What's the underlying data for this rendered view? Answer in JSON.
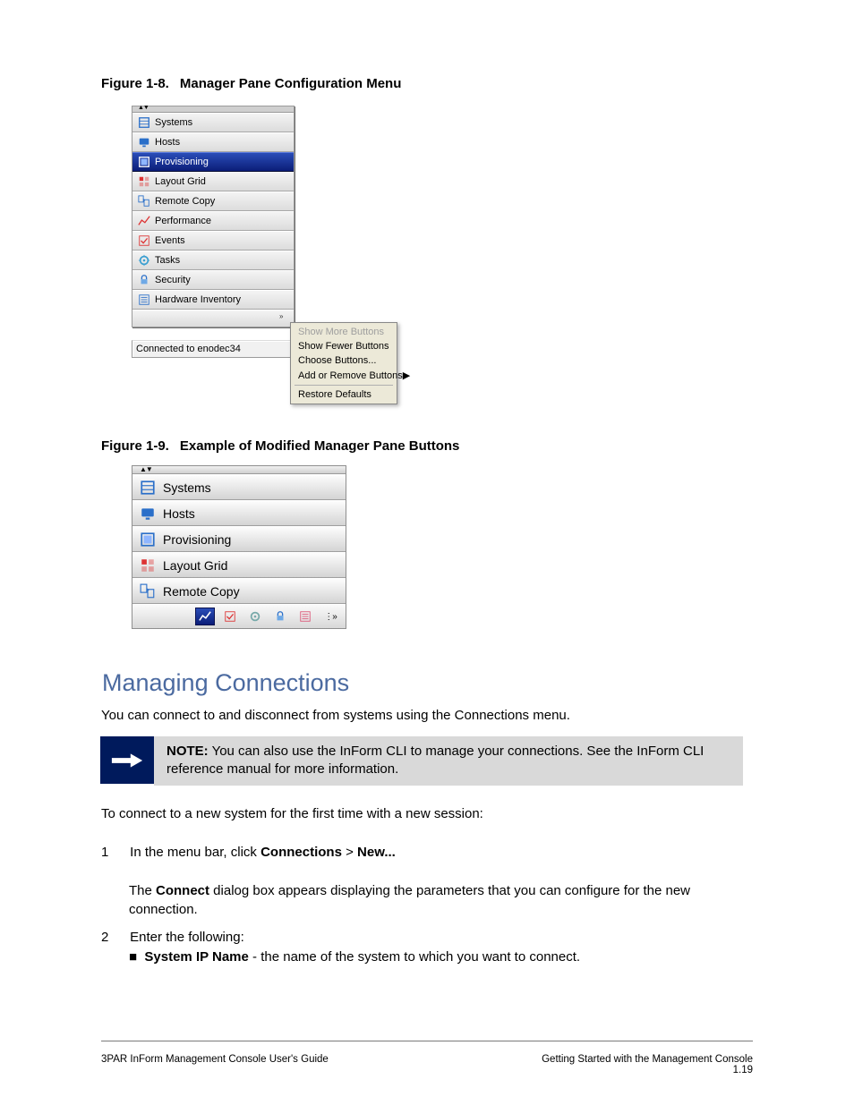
{
  "figure1": {
    "caption_label": "Figure 1-8.",
    "caption_text": "Manager Pane Configuration Menu",
    "nav_items": [
      {
        "label": "Systems",
        "selected": false,
        "icon": "systems-icon"
      },
      {
        "label": "Hosts",
        "selected": false,
        "icon": "hosts-icon"
      },
      {
        "label": "Provisioning",
        "selected": true,
        "icon": "provisioning-icon"
      },
      {
        "label": "Layout Grid",
        "selected": false,
        "icon": "layout-grid-icon"
      },
      {
        "label": "Remote Copy",
        "selected": false,
        "icon": "remote-copy-icon"
      },
      {
        "label": "Performance",
        "selected": false,
        "icon": "performance-icon"
      },
      {
        "label": "Events",
        "selected": false,
        "icon": "events-icon"
      },
      {
        "label": "Tasks",
        "selected": false,
        "icon": "tasks-icon"
      },
      {
        "label": "Security",
        "selected": false,
        "icon": "security-icon"
      },
      {
        "label": "Hardware Inventory",
        "selected": false,
        "icon": "hardware-inventory-icon"
      }
    ],
    "status_text": "Connected to enodec34",
    "context_menu": [
      {
        "label": "Show More Buttons",
        "disabled": true,
        "submenu": false
      },
      {
        "label": "Show Fewer Buttons",
        "disabled": false,
        "submenu": false
      },
      {
        "label": "Choose Buttons...",
        "disabled": false,
        "submenu": false
      },
      {
        "label": "Add or Remove Buttons",
        "disabled": false,
        "submenu": true
      },
      {
        "label": "Restore Defaults",
        "disabled": false,
        "submenu": false,
        "separator_above": true
      }
    ]
  },
  "figure2": {
    "caption_label": "Figure 1-9.",
    "caption_text": "Example of Modified Manager Pane Buttons",
    "nav_items": [
      {
        "label": "Systems",
        "icon": "systems-icon"
      },
      {
        "label": "Hosts",
        "icon": "hosts-icon"
      },
      {
        "label": "Provisioning",
        "icon": "provisioning-icon"
      },
      {
        "label": "Layout Grid",
        "icon": "layout-grid-icon"
      },
      {
        "label": "Remote Copy",
        "icon": "remote-copy-icon"
      }
    ],
    "overflow": [
      {
        "name": "performance-icon",
        "selected": true
      },
      {
        "name": "events-icon",
        "selected": false
      },
      {
        "name": "tasks-icon",
        "selected": false
      },
      {
        "name": "security-icon",
        "selected": false
      },
      {
        "name": "hardware-inventory-icon",
        "selected": false
      },
      {
        "name": "configure-icon",
        "selected": false
      }
    ]
  },
  "section": {
    "title": "Managing Connections",
    "p1": "You can connect to and disconnect from systems using the Connections menu.",
    "note_label": "NOTE:",
    "note_text": "You can also use the InForm CLI to manage your connections. See the InForm CLI reference manual for more information.",
    "p2": "To connect to a new system for the first time with a new session:",
    "step1_no": "1",
    "step1": "In the menu bar, click Connections > New...",
    "step1b": "The Connect dialog box appears displaying the parameters that you can configure for the new connection.",
    "step2_no": "2",
    "step2": "Enter the following:",
    "step2a_label": "System IP Name",
    "step2a_text": " - the name of the system to which you want to connect.",
    "footer_left": "3PAR InForm Management Console User's Guide",
    "footer_right_title": "Getting Started with the Management Console",
    "footer_right_page": "1.19"
  }
}
